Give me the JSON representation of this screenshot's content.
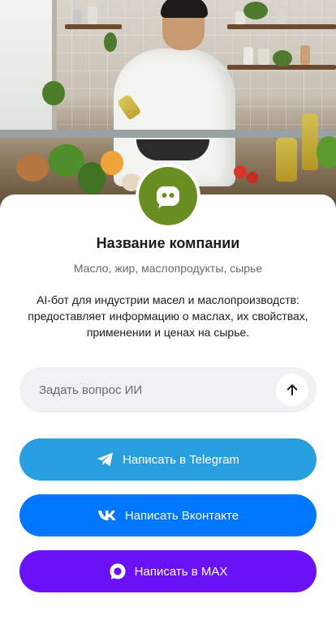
{
  "company": {
    "name": "Название компании",
    "subtitle": "Масло, жир, маслопродукты, сырье",
    "description": "AI-бот для индустрии масел и маслопроизводств: предоставляет информацию о маслах, их свойствах, применении и ценах на сырье.",
    "avatar_icon": "chat-bot-icon",
    "avatar_color": "#6b8e23"
  },
  "ask": {
    "placeholder": "Задать вопрос ИИ",
    "value": "",
    "send_icon": "arrow-up-icon"
  },
  "buttons": {
    "telegram": {
      "label": "Написать в Telegram",
      "icon": "telegram-icon",
      "color": "#2a9fe0"
    },
    "vk": {
      "label": "Написать Вконтакте",
      "icon": "vk-icon",
      "color": "#0077ff"
    },
    "max": {
      "label": "Написать в MAX",
      "icon": "max-icon",
      "color": "#6a11f5"
    }
  },
  "hero": {
    "image": "chef-cooking-photo"
  }
}
